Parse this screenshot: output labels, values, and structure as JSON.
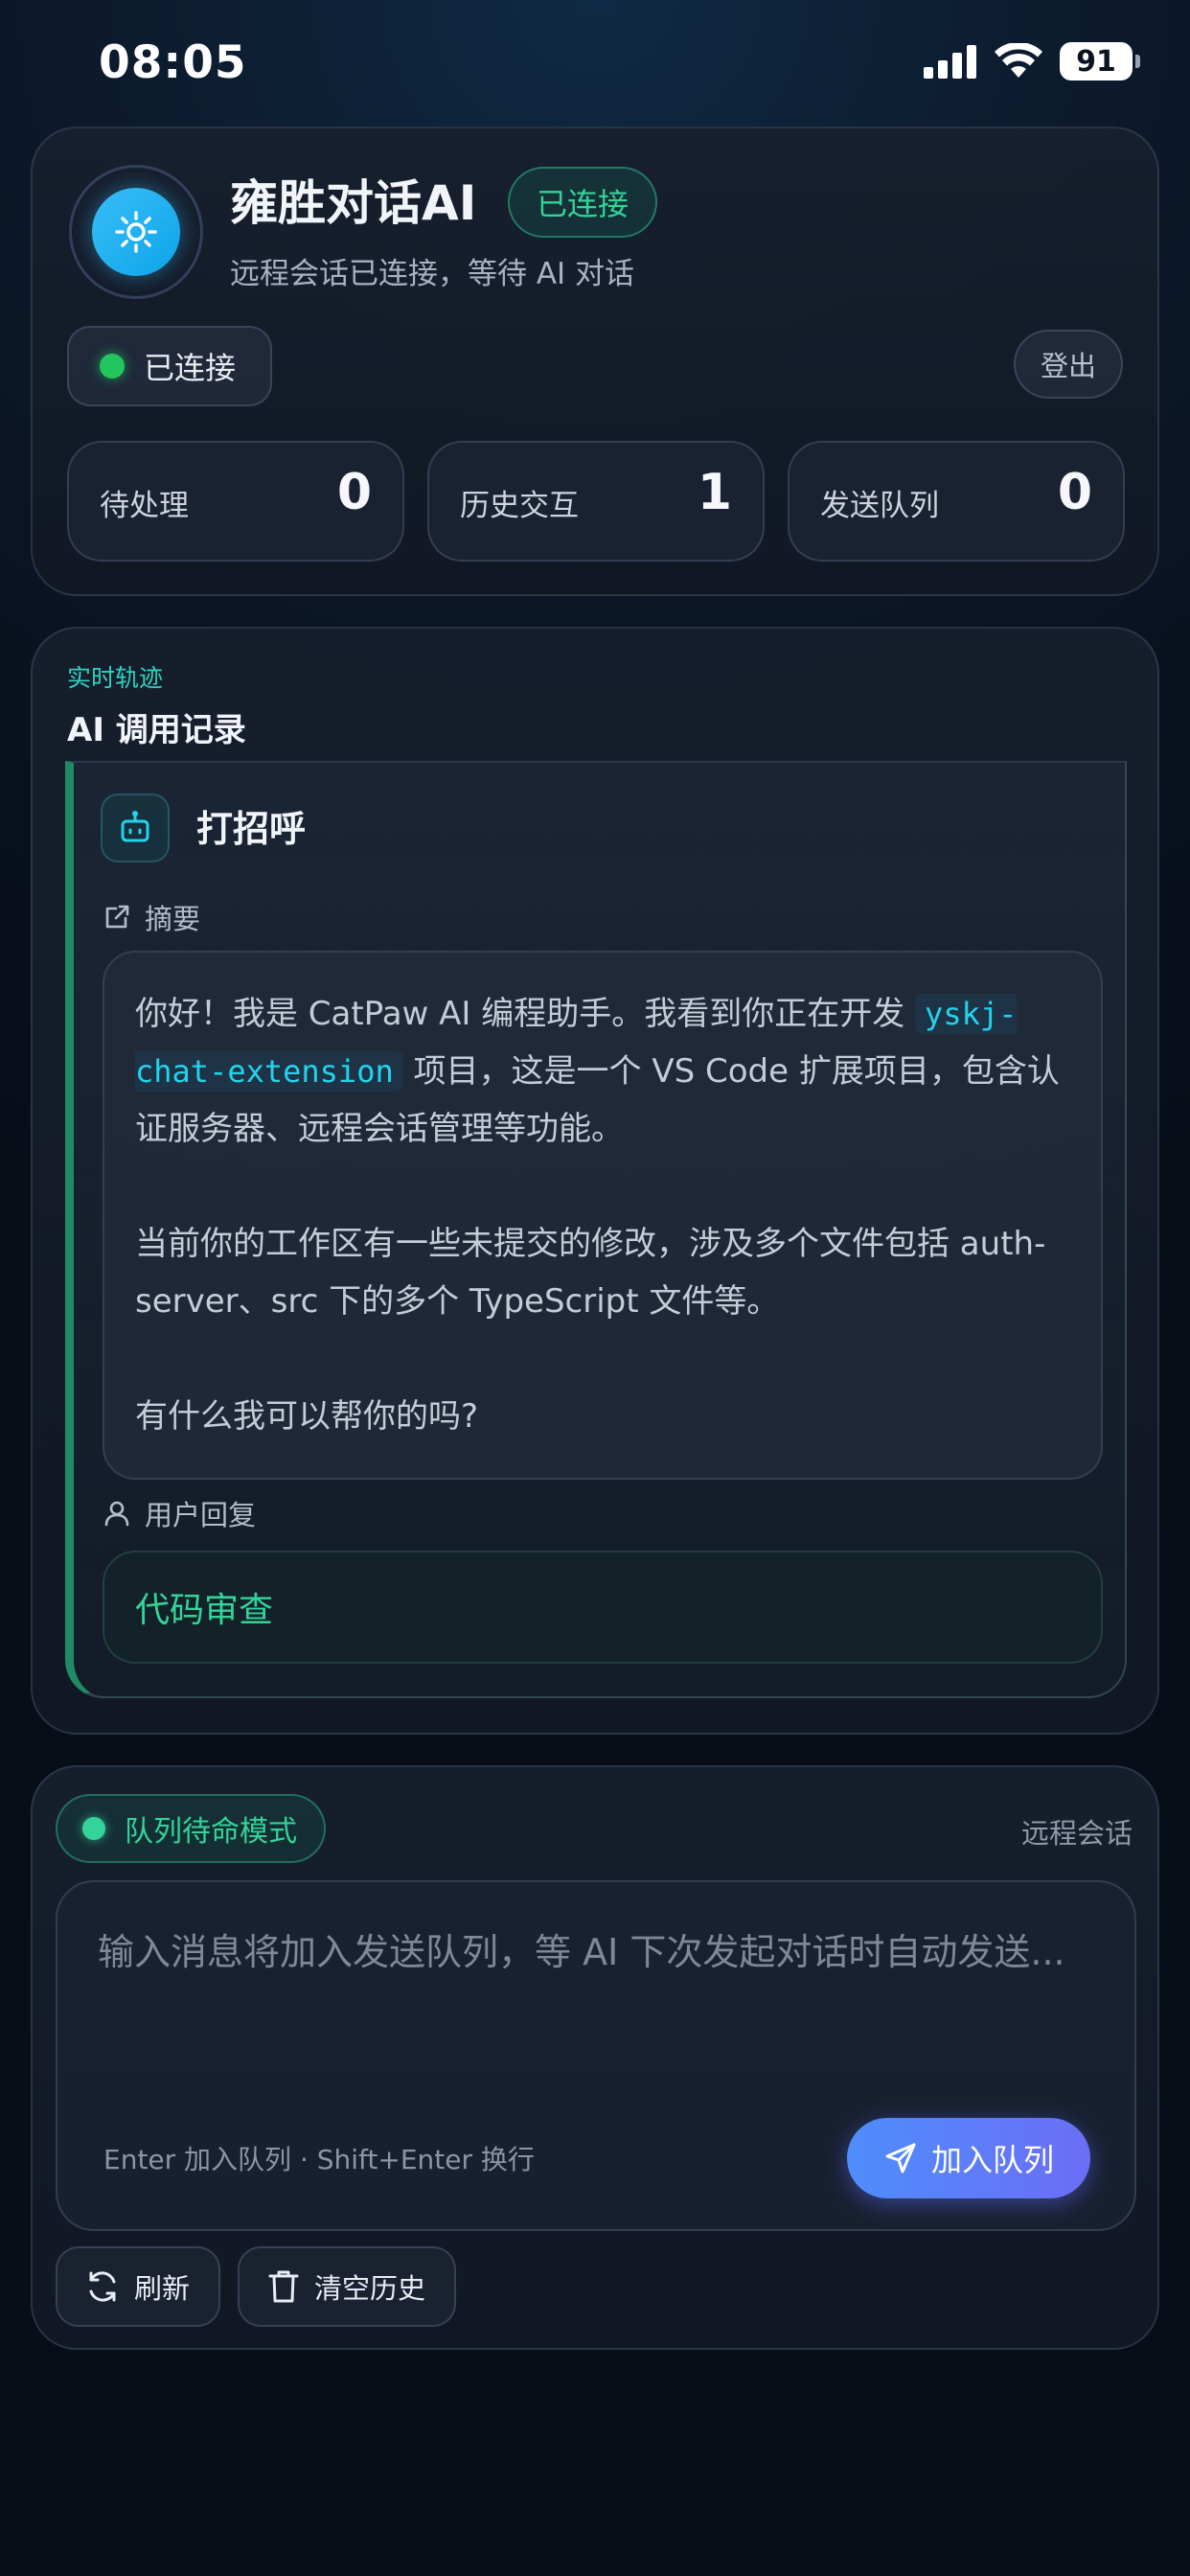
{
  "status_bar": {
    "time": "08:05",
    "battery": "91"
  },
  "header": {
    "title": "雍胜对话AI",
    "badge": "已连接",
    "subtitle": "远程会话已连接，等待 AI 对话",
    "connection_status": "已连接",
    "logout_label": "登出",
    "stats": [
      {
        "label": "待处理",
        "value": "0"
      },
      {
        "label": "历史交互",
        "value": "1"
      },
      {
        "label": "发送队列",
        "value": "0"
      }
    ]
  },
  "records": {
    "eyebrow": "实时轨迹",
    "title": "AI 调用记录",
    "item": {
      "title": "打招呼",
      "summary_label": "摘要",
      "summary": {
        "p1_before": "你好！我是 CatPaw AI 编程助手。我看到你正在开发",
        "p1_code": "yskj-chat-extension",
        "p1_after": "项目，这是一个 VS Code 扩展项目，包含认证服务器、远程会话管理等功能。",
        "p2": "当前你的工作区有一些未提交的修改，涉及多个文件包括 auth-server、src 下的多个 TypeScript 文件等。",
        "p3": "有什么我可以帮你的吗?"
      },
      "reply_label": "用户回复",
      "reply": "代码审查"
    }
  },
  "composer": {
    "mode": "队列待命模式",
    "remote_label": "远程会话",
    "placeholder": "输入消息将加入发送队列，等 AI 下次发起对话时自动发送...",
    "hint": "Enter 加入队列 · Shift+Enter 换行",
    "send_label": "加入队列",
    "refresh_label": "刷新",
    "clear_label": "清空历史"
  },
  "colors": {
    "accent_green": "#34d399",
    "accent_cyan": "#22d3ee",
    "button_gradient_start": "#4f8dfb",
    "button_gradient_end": "#6b6ef6"
  },
  "icons": {
    "logo": "sun-icon",
    "record": "robot-icon",
    "summary": "external-link-icon",
    "reply": "user-icon",
    "send": "send-icon",
    "refresh": "refresh-icon",
    "clear": "trash-icon"
  }
}
